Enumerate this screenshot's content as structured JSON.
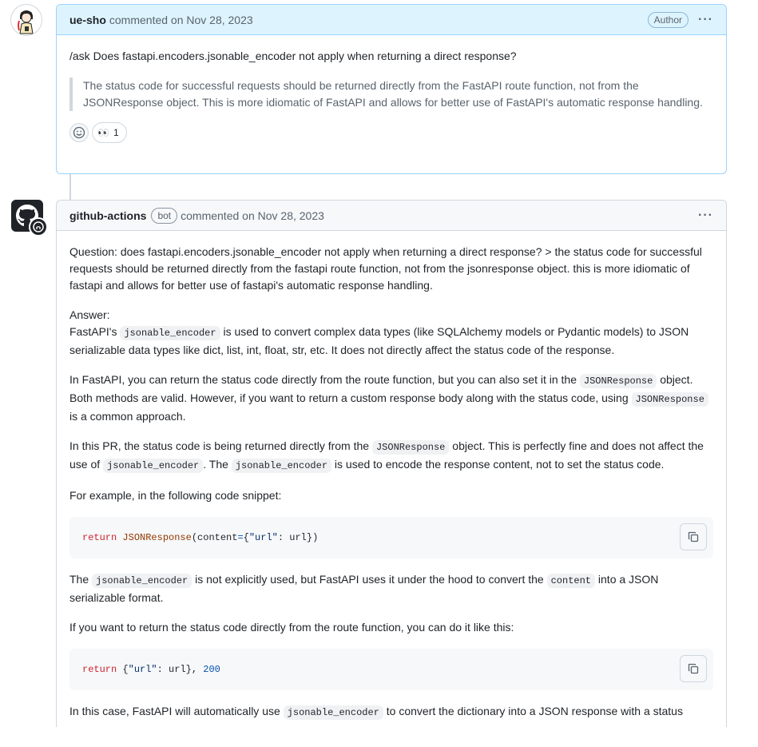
{
  "comment1": {
    "author": "ue-sho",
    "meta": "commented on Nov 28, 2023",
    "badge": "Author",
    "body": "/ask Does fastapi.encoders.jsonable_encoder not apply when returning a direct response?",
    "quote": "The status code for successful requests should be returned directly from the FastAPI route function, not from the JSONResponse object. This is more idiomatic of FastAPI and allows for better use of FastAPI's automatic response handling.",
    "reaction_emoji": "👀",
    "reaction_count": "1"
  },
  "comment2": {
    "author": "github-actions",
    "badge": "bot",
    "meta": "commented on Nov 28, 2023",
    "p1": "Question: does fastapi.encoders.jsonable_encoder not apply when returning a direct response? > the status code for successful requests should be returned directly from the fastapi route function, not from the jsonresponse object. this is more idiomatic of fastapi and allows for better use of fastapi's automatic response handling.",
    "answer_label": "Answer:",
    "p2_a": "FastAPI's ",
    "p2_code": "jsonable_encoder",
    "p2_b": " is used to convert complex data types (like SQLAlchemy models or Pydantic models) to JSON serializable data types like dict, list, int, float, str, etc. It does not directly affect the status code of the response.",
    "p3_a": "In FastAPI, you can return the status code directly from the route function, but you can also set it in the ",
    "p3_code1": "JSONResponse",
    "p3_b": " object. Both methods are valid. However, if you want to return a custom response body along with the status code, using ",
    "p3_code2": "JSONResponse",
    "p3_c": " is a common approach.",
    "p4_a": "In this PR, the status code is being returned directly from the ",
    "p4_code1": "JSONResponse",
    "p4_b": " object. This is perfectly fine and does not affect the use of ",
    "p4_code2": "jsonable_encoder",
    "p4_c": ". The ",
    "p4_code3": "jsonable_encoder",
    "p4_d": " is used to encode the response content, not to set the status code.",
    "p5": "For example, in the following code snippet:",
    "code1": {
      "kw": "return",
      "fn": "JSONResponse",
      "a": "(content",
      "eq": "=",
      "b": "{",
      "s": "\"url\"",
      "c": ": url})"
    },
    "p6_a": "The ",
    "p6_code1": "jsonable_encoder",
    "p6_b": " is not explicitly used, but FastAPI uses it under the hood to convert the ",
    "p6_code2": "content",
    "p6_c": " into a JSON serializable format.",
    "p7": "If you want to return the status code directly from the route function, you can do it like this:",
    "code2": {
      "kw": "return",
      "a": " {",
      "s": "\"url\"",
      "b": ": url}, ",
      "num": "200"
    },
    "p8_a": "In this case, FastAPI will automatically use ",
    "p8_code": "jsonable_encoder",
    "p8_b": " to convert the dictionary into a JSON response with a status"
  }
}
